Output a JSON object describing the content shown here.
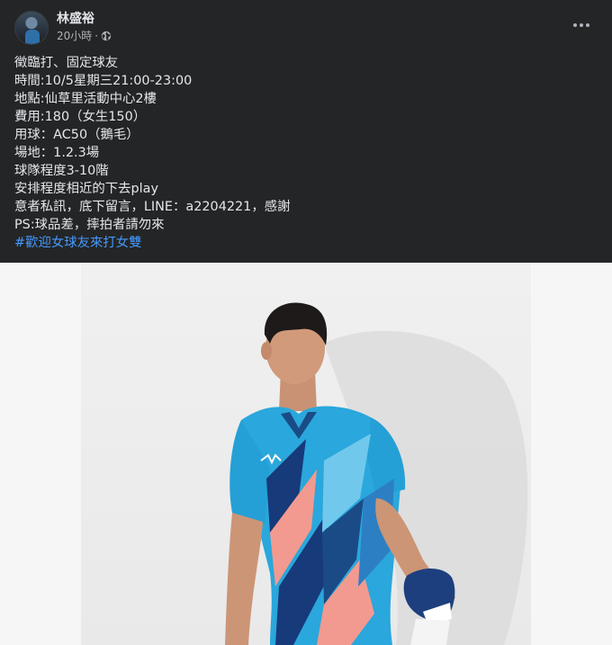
{
  "post": {
    "author": "林盛裕",
    "time": "20小時",
    "separator": "·",
    "privacy_icon": "globe-icon",
    "more_icon": "more-horizontal-icon",
    "lines": [
      "徵臨打、固定球友",
      "時間:10/5星期三21:00-23:00",
      "地點:仙草里活動中心2樓",
      "費用:180（女生150）",
      "用球：AC50（鵝毛）",
      "場地：1.2.3場",
      "球隊程度3-10階",
      "安排程度相近的下去play",
      "意者私訊，底下留言，LINE：a2204221，感謝",
      "PS:球品差，摔拍者請勿來"
    ],
    "hashtag": "#歡迎女球友來打女雙"
  },
  "colors": {
    "background": "#242526",
    "text": "#e4e6eb",
    "secondary_text": "#b0b3b8",
    "link": "#4599ff",
    "shirt_blue": "#2aa7dc",
    "shirt_navy": "#173a7a",
    "shirt_pink": "#f29a8f"
  }
}
